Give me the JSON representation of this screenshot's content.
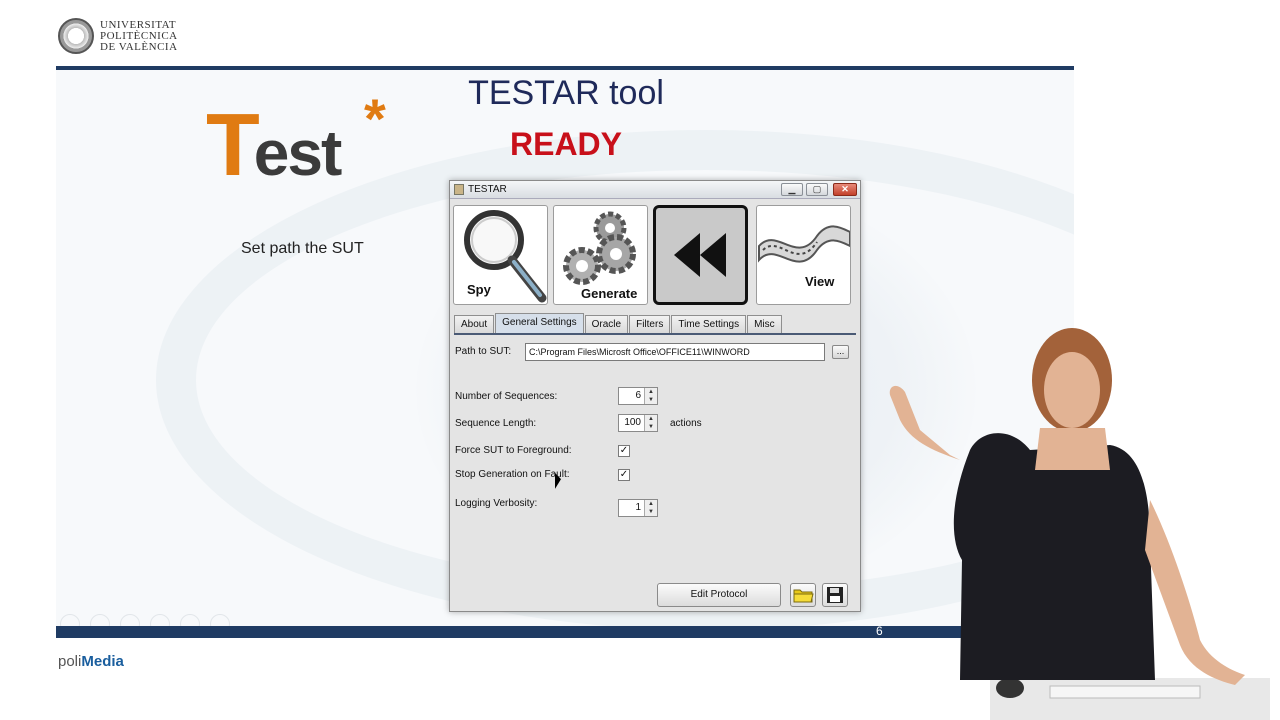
{
  "university": {
    "line1": "UNIVERSITAT",
    "line2": "POLITÈCNICA",
    "line3": "DE VALÈNCIA"
  },
  "slide": {
    "logo_t": "T",
    "logo_rest": "est",
    "logo_star": "*",
    "title": "TESTAR tool",
    "status": "READY",
    "caption": "Set path the SUT",
    "page_number": "6"
  },
  "window": {
    "title": "TESTAR",
    "min_glyph": "▁",
    "max_glyph": "▢",
    "close_glyph": "✕",
    "modes": [
      {
        "label": "Spy",
        "icon": "magnifier-icon"
      },
      {
        "label": "Generate",
        "icon": "gears-icon"
      },
      {
        "label": "",
        "icon": "rewind-icon"
      },
      {
        "label": "View",
        "icon": "film-reel-icon"
      }
    ],
    "tabs": [
      "About",
      "General Settings",
      "Oracle",
      "Filters",
      "Time Settings",
      "Misc"
    ],
    "active_tab": "General Settings",
    "form": {
      "path_label": "Path to SUT:",
      "path_value": "C:\\Program Files\\Microsft Office\\OFFICE11\\WINWORD",
      "browse_label": "...",
      "num_sequences_label": "Number of Sequences:",
      "num_sequences_value": "6",
      "sequence_length_label": "Sequence Length:",
      "sequence_length_value": "100",
      "sequence_length_unit": "actions",
      "force_foreground_label": "Force SUT to Foreground:",
      "force_foreground_checked": "✓",
      "stop_on_fault_label": "Stop Generation on Fault:",
      "stop_on_fault_checked": "✓",
      "logging_label": "Logging Verbosity:",
      "logging_value": "1",
      "spinner_up": "▲",
      "spinner_down": "▼"
    },
    "edit_protocol_label": "Edit Protocol"
  },
  "footer": {
    "poli": "poli",
    "media": "Media"
  },
  "colors": {
    "accent_orange": "#e07b12",
    "title_navy": "#1f2a5a",
    "ready_red": "#c8101a",
    "slide_bar": "#1f3b63",
    "polimedia_blue": "#1a5e9e"
  }
}
